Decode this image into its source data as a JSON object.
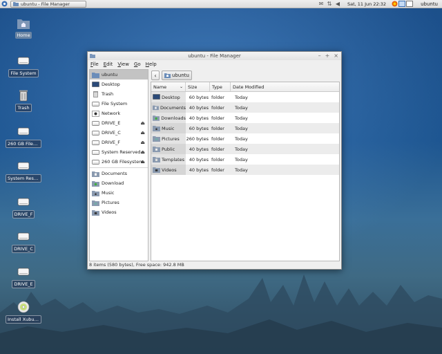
{
  "panel": {
    "task_label": "ubuntu - File Manager",
    "clock": "Sat, 11 Jun  22:32",
    "user": "ubuntu"
  },
  "desktop_icons": [
    {
      "label": "Home",
      "icon": "home-folder-icon",
      "selected": true
    },
    {
      "label": "File System",
      "icon": "drive-icon"
    },
    {
      "label": "Trash",
      "icon": "trash-icon"
    },
    {
      "label": "260 GB Filesy...",
      "icon": "drive-icon"
    },
    {
      "label": "System Rese...",
      "icon": "drive-icon"
    },
    {
      "label": "DRIVE_F",
      "icon": "drive-icon"
    },
    {
      "label": "DRIVE_C",
      "icon": "drive-icon"
    },
    {
      "label": "DRIVE_E",
      "icon": "drive-icon"
    },
    {
      "label": "Install Xubun...",
      "icon": "cd-icon"
    }
  ],
  "window": {
    "title": "ubuntu - File Manager",
    "menu": [
      "File",
      "Edit",
      "View",
      "Go",
      "Help"
    ],
    "sidebar": [
      {
        "label": "ubuntu",
        "icon": "home-folder-icon",
        "selected": true
      },
      {
        "label": "Desktop",
        "icon": "desktop-icon"
      },
      {
        "label": "Trash",
        "icon": "trash-icon"
      },
      {
        "label": "File System",
        "icon": "drive-icon"
      },
      {
        "label": "Network",
        "icon": "network-icon"
      },
      {
        "label": "DRIVE_E",
        "icon": "drive-icon",
        "eject": true
      },
      {
        "label": "DRIVE_C",
        "icon": "drive-icon",
        "eject": true
      },
      {
        "label": "DRIVE_F",
        "icon": "drive-icon",
        "eject": true
      },
      {
        "label": "System Reserved",
        "icon": "drive-icon",
        "eject": true
      },
      {
        "label": "260 GB Filesystem",
        "icon": "drive-icon",
        "eject": true
      },
      {
        "label": "Documents",
        "icon": "documents-folder-icon",
        "group_start": true
      },
      {
        "label": "Download",
        "icon": "download-folder-icon"
      },
      {
        "label": "Music",
        "icon": "music-folder-icon"
      },
      {
        "label": "Pictures",
        "icon": "pictures-folder-icon"
      },
      {
        "label": "Videos",
        "icon": "videos-folder-icon"
      }
    ],
    "path": {
      "back": "‹",
      "crumb": "ubuntu"
    },
    "columns": [
      "Name",
      "Size",
      "Type",
      "Date Modified"
    ],
    "rows": [
      {
        "name": "Desktop",
        "size": "60 bytes",
        "type": "folder",
        "date": "Today"
      },
      {
        "name": "Documents",
        "size": "40 bytes",
        "type": "folder",
        "date": "Today"
      },
      {
        "name": "Downloads",
        "size": "40 bytes",
        "type": "folder",
        "date": "Today"
      },
      {
        "name": "Music",
        "size": "60 bytes",
        "type": "folder",
        "date": "Today"
      },
      {
        "name": "Pictures",
        "size": "260 bytes",
        "type": "folder",
        "date": "Today"
      },
      {
        "name": "Public",
        "size": "40 bytes",
        "type": "folder",
        "date": "Today"
      },
      {
        "name": "Templates",
        "size": "40 bytes",
        "type": "folder",
        "date": "Today"
      },
      {
        "name": "Videos",
        "size": "40 bytes",
        "type": "folder",
        "date": "Today"
      }
    ],
    "status": "8 items (580 bytes), Free space: 942.8 MB"
  }
}
